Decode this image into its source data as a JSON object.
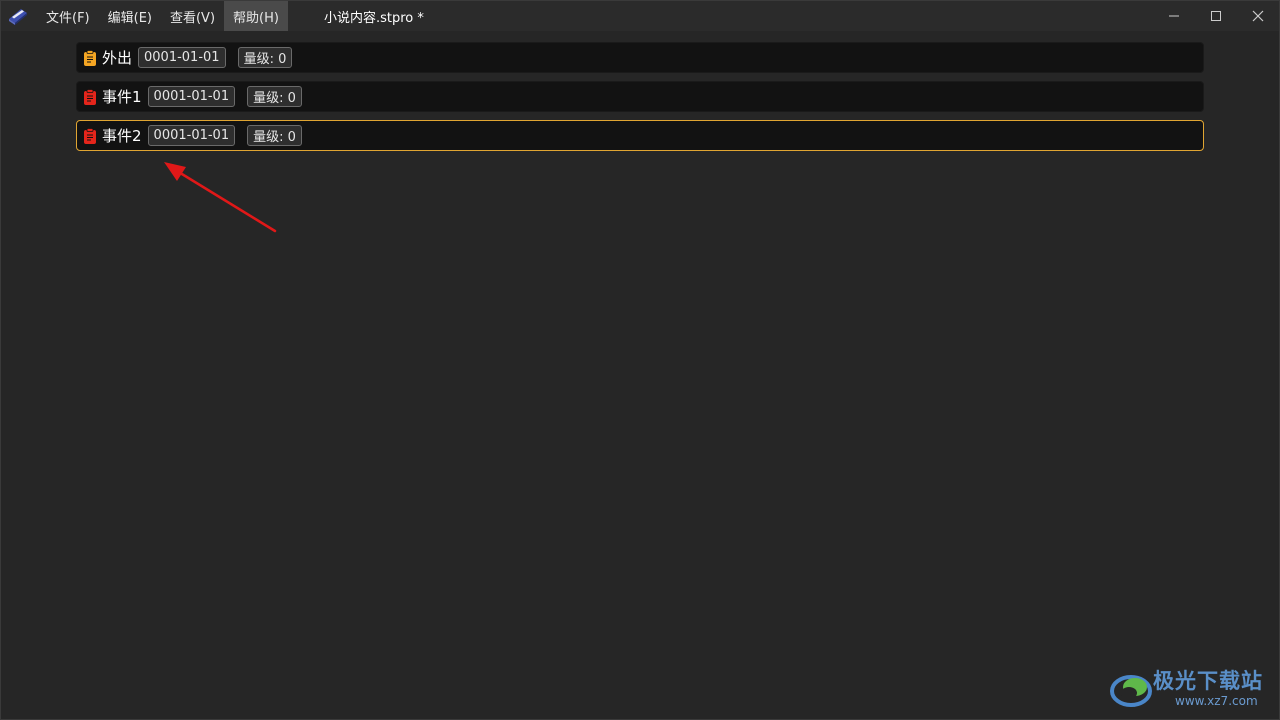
{
  "menu": [
    {
      "label": "文件(F)"
    },
    {
      "label": "编辑(E)"
    },
    {
      "label": "查看(V)"
    },
    {
      "label": "帮助(H)"
    }
  ],
  "document_title": "小说内容.stpro *",
  "events": [
    {
      "name": "外出",
      "date": "0001-01-01",
      "level": "量级: 0",
      "icon_color": "#f5a623",
      "selected": false
    },
    {
      "name": "事件1",
      "date": "0001-01-01",
      "level": "量级: 0",
      "icon_color": "#e5251b",
      "selected": false
    },
    {
      "name": "事件2",
      "date": "0001-01-01",
      "level": "量级: 0",
      "icon_color": "#e5251b",
      "selected": true
    }
  ],
  "colors": {
    "selected_border": "#e0a532",
    "annotation_arrow": "#e01818"
  },
  "watermark": {
    "text": "极光下载站",
    "url": "www.xz7.com"
  }
}
